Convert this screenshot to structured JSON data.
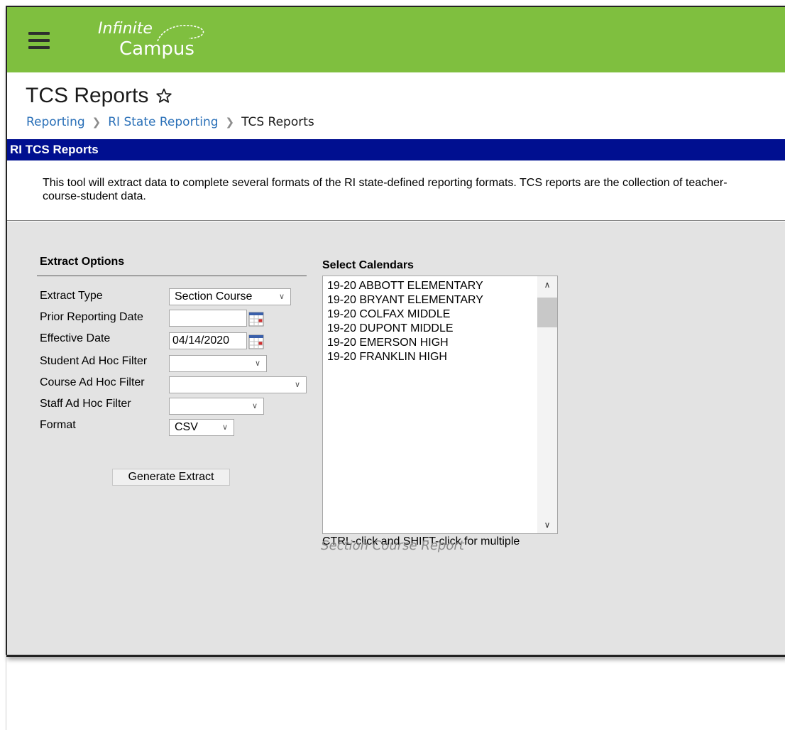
{
  "brand": {
    "logo_top": "Infinite",
    "logo_bottom": "Campus",
    "bar_color": "#7fbf3f"
  },
  "header": {
    "title": "TCS Reports",
    "star_icon": "star-outline-icon"
  },
  "breadcrumb": {
    "items": [
      "Reporting",
      "RI State Reporting",
      "TCS Reports"
    ],
    "separator": ">"
  },
  "section": {
    "title": "RI TCS Reports",
    "color": "#000f90",
    "description": "This tool will extract data to complete several formats of the RI state-defined reporting formats. TCS reports are the collection of teacher-course-student data."
  },
  "extract_options": {
    "heading": "Extract Options",
    "extract_type": {
      "label": "Extract Type",
      "value": "Section Course"
    },
    "prior_reporting_date": {
      "label": "Prior Reporting Date",
      "value": ""
    },
    "effective_date": {
      "label": "Effective Date",
      "value": "04/14/2020"
    },
    "student_filter": {
      "label": "Student Ad Hoc Filter",
      "value": ""
    },
    "course_filter": {
      "label": "Course Ad Hoc Filter",
      "value": ""
    },
    "staff_filter": {
      "label": "Staff Ad Hoc Filter",
      "value": ""
    },
    "format": {
      "label": "Format",
      "value": "CSV"
    },
    "generate_button": "Generate Extract"
  },
  "calendars": {
    "heading": "Select Calendars",
    "items": [
      "19-20 ABBOTT ELEMENTARY",
      "19-20 BRYANT ELEMENTARY",
      "19-20 COLFAX MIDDLE",
      "19-20 DUPONT MIDDLE",
      "19-20 EMERSON HIGH",
      "19-20 FRANKLIN HIGH"
    ],
    "hint": "CTRL-click and SHIFT-click for multiple"
  },
  "caption": "Section Course Report"
}
